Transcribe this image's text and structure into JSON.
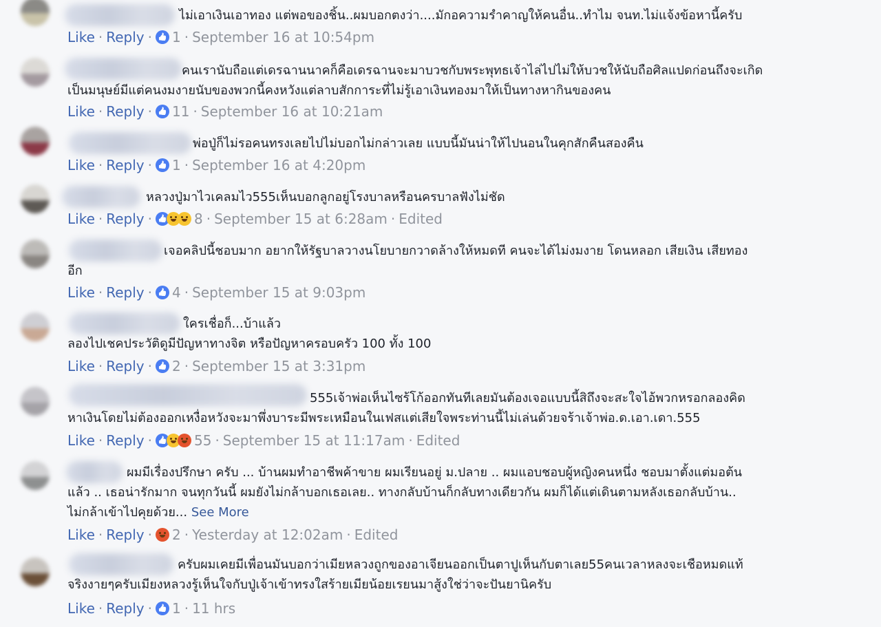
{
  "ui": {
    "like": "Like",
    "reply": "Reply",
    "see_more": "See More",
    "dot": "·"
  },
  "colors": {
    "link": "#4267b2",
    "meta": "#90949c",
    "like_reaction": "#4a7df2",
    "haha_reaction": "#f7c430",
    "angry_reaction": "#e4532e",
    "background": "#f6f7f9"
  },
  "comments": [
    {
      "line1": "ไม่เอาเงินเอาทอง แต่พอของชิ้น..ผมบอกตงว่า....มักอความรำคาญให้คนอื่น..ทำไม จนท.ไม่แจ้งข้อหานี้ครับ",
      "line2": "",
      "reactions": [
        "like"
      ],
      "count": "1",
      "time": "September 16 at 10:54pm",
      "edited": ""
    },
    {
      "line1": "คนเรานับถือแต่เดรฉานนาคก็คือเดรฉานจะมาบวชกับพระพุทธเจ้าไล่ไปไม่ให้บวชให้นับถือศิลแปดก่อนถึงจะเกิด",
      "line2": "เป็นมนุษย์มีแต่คนงมงายนับของพวกนี้คงหวังแต่ลาบสักการะที่ไม่รู้เอาเงินทองมาให้เป็นทางหากินของคน",
      "reactions": [
        "like"
      ],
      "count": "11",
      "time": "September 16 at 10:21am",
      "edited": ""
    },
    {
      "line1": "พ่อปู่ก็ไม่รอคนทรงเลยไปไม่บอกไม่กล่าวเลย แบบนี้มันน่าให้ไปนอนในคุกสักคืนสองคืน",
      "line2": "",
      "reactions": [
        "like"
      ],
      "count": "1",
      "time": "September 16 at 4:20pm",
      "edited": ""
    },
    {
      "line1": "หลวงปู่มาไวเคลมไว555เห็นบอกลูกอยู่โรงบาลหรือนครบาลฟังไม่ชัด",
      "line2": "",
      "reactions": [
        "like",
        "haha",
        "haha"
      ],
      "count": "8",
      "time": "September 15 at 6:28am",
      "edited": "Edited"
    },
    {
      "line1": "เจอคลิปนี้ชอบมาก อยากให้รัฐบาลวางนโยบายกวาดล้างให้หมดที คนจะได้ไม่งมงาย โดนหลอก เสียเงิน เสียทอง",
      "line2": "อีก",
      "reactions": [
        "like"
      ],
      "count": "4",
      "time": "September 15 at 9:03pm",
      "edited": ""
    },
    {
      "line1": "ใครเชื่อก็...บ้าแล้ว",
      "line2": "ลองไปเชคประวัติดูมีปัญหาทางจิต หรือปัญหาครอบครัว 100 ทั้ง 100",
      "reactions": [
        "like"
      ],
      "count": "2",
      "time": "September 15 at 3:31pm",
      "edited": ""
    },
    {
      "line1": "555เจ้าพ่อเห็นไซร้โก้ออกทันทีเลยมันต้องเจอแบบนี้สิถึงจะสะใจไอ้พวกหรอกลองคิด",
      "line2": "หาเงินโดยไม่ต้องออกเหงื่อหวังจะมาพึ่งบาระมีพระเหมือนในเฟสแต่เสียใจพระท่านนี้ไม่เล่นด้วยจร้าเจ้าพ่อ.ด.เอา.เดา.555",
      "reactions": [
        "like",
        "haha",
        "angry"
      ],
      "count": "55",
      "time": "September 15 at 11:17am",
      "edited": "Edited"
    },
    {
      "line1": "ผมมีเรื่องปรึกษา ครับ ... บ้านผมทำอาชีพค้าขาย ผมเรียนอยู่ ม.ปลาย .. ผมแอบชอบผู้หญิงคนหนึ่ง ชอบมาตั้งแต่มอต้น",
      "line2": "แล้ว .. เธอน่ารักมาก จนทุกวันนี้ ผมยังไม่กล้าบอกเธอเลย.. ทางกลับบ้านก็กลับทางเดียวกัน ผมก็ได้แต่เดินตามหลังเธอกลับบ้าน..",
      "line3": "ไม่กล้าเข้าไปคุยด้วย...",
      "reactions": [
        "angry"
      ],
      "count": "2",
      "time": "Yesterday at 12:02am",
      "edited": "Edited"
    },
    {
      "line1": "ครับผมเคยมีเพื่อนมันบอกว่าเมียหลวงถูกของอาเจียนออกเป็นตาปูเห็นกับตาเลย55คนเวลาหลงจะเชือหมดแท้",
      "line2": "จริงงายๆครับเมียงหลวงรู้เห็นใจกับปู่เจ้าเข้าทรงใสร้ายเมียน้อยเรยนมาสู้งใช่ว่าจะปันยานิครับ",
      "reactions": [
        "like"
      ],
      "count": "1",
      "time": "11 hrs",
      "edited": ""
    }
  ]
}
